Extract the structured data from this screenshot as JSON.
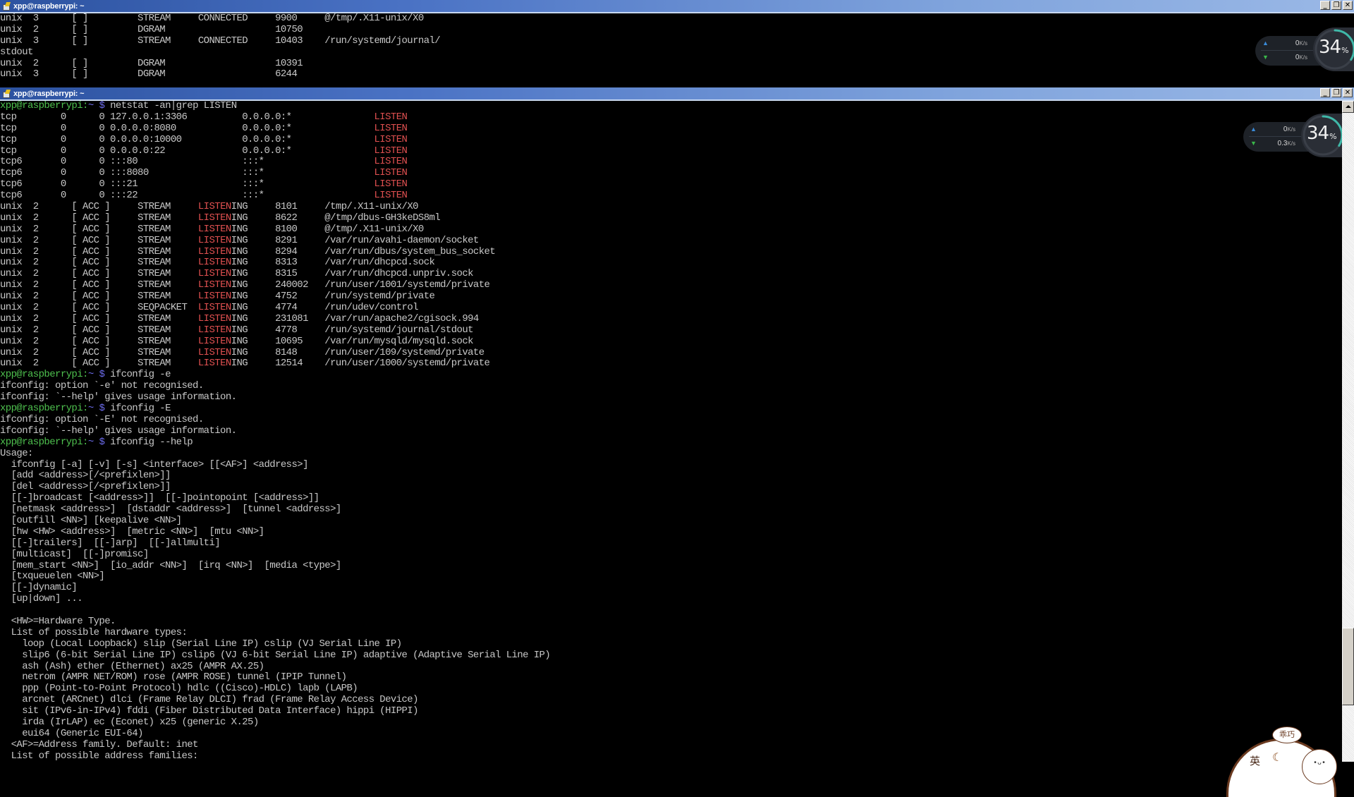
{
  "windows": {
    "top": {
      "title": "xpp@raspberrypi: ~",
      "lines": [
        {
          "segs": [
            [
              "unix  3      [ ]         STREAM     CONNECTED     9900     @/tmp/.X11-unix/X0",
              ""
            ]
          ]
        },
        {
          "segs": [
            [
              "unix  2      [ ]         DGRAM                    10750",
              ""
            ]
          ]
        },
        {
          "segs": [
            [
              "unix  3      [ ]         STREAM     CONNECTED     10403    /run/systemd/journal/",
              ""
            ]
          ]
        },
        {
          "segs": [
            [
              "stdout",
              ""
            ]
          ]
        },
        {
          "segs": [
            [
              "unix  2      [ ]         DGRAM                    10391",
              ""
            ]
          ]
        },
        {
          "segs": [
            [
              "unix  3      [ ]         DGRAM                    6244",
              ""
            ]
          ]
        }
      ]
    },
    "main": {
      "title": "xpp@raspberrypi: ~",
      "lines": [
        {
          "segs": [
            [
              "xpp@raspberrypi:",
              "g"
            ],
            [
              "~",
              "b"
            ],
            [
              " ",
              ""
            ],
            [
              "$",
              "b"
            ],
            [
              " netstat -an|grep LISTEN",
              ""
            ]
          ]
        },
        {
          "segs": [
            [
              "tcp        0      0 127.0.0.1:3306          0.0.0.0:*               ",
              ""
            ],
            [
              "LISTEN",
              "r"
            ]
          ]
        },
        {
          "segs": [
            [
              "tcp        0      0 0.0.0.0:8080            0.0.0.0:*               ",
              ""
            ],
            [
              "LISTEN",
              "r"
            ]
          ]
        },
        {
          "segs": [
            [
              "tcp        0      0 0.0.0.0:10000           0.0.0.0:*               ",
              ""
            ],
            [
              "LISTEN",
              "r"
            ]
          ]
        },
        {
          "segs": [
            [
              "tcp        0      0 0.0.0.0:22              0.0.0.0:*               ",
              ""
            ],
            [
              "LISTEN",
              "r"
            ]
          ]
        },
        {
          "segs": [
            [
              "tcp6       0      0 :::80                   :::*                    ",
              ""
            ],
            [
              "LISTEN",
              "r"
            ]
          ]
        },
        {
          "segs": [
            [
              "tcp6       0      0 :::8080                 :::*                    ",
              ""
            ],
            [
              "LISTEN",
              "r"
            ]
          ]
        },
        {
          "segs": [
            [
              "tcp6       0      0 :::21                   :::*                    ",
              ""
            ],
            [
              "LISTEN",
              "r"
            ]
          ]
        },
        {
          "segs": [
            [
              "tcp6       0      0 :::22                   :::*                    ",
              ""
            ],
            [
              "LISTEN",
              "r"
            ]
          ]
        },
        {
          "segs": [
            [
              "unix  2      [ ACC ]     STREAM     ",
              ""
            ],
            [
              "LISTEN",
              "r"
            ],
            [
              "ING     8101     /tmp/.X11-unix/X0",
              ""
            ]
          ]
        },
        {
          "segs": [
            [
              "unix  2      [ ACC ]     STREAM     ",
              ""
            ],
            [
              "LISTEN",
              "r"
            ],
            [
              "ING     8622     @/tmp/dbus-GH3keDS8ml",
              ""
            ]
          ]
        },
        {
          "segs": [
            [
              "unix  2      [ ACC ]     STREAM     ",
              ""
            ],
            [
              "LISTEN",
              "r"
            ],
            [
              "ING     8100     @/tmp/.X11-unix/X0",
              ""
            ]
          ]
        },
        {
          "segs": [
            [
              "unix  2      [ ACC ]     STREAM     ",
              ""
            ],
            [
              "LISTEN",
              "r"
            ],
            [
              "ING     8291     /var/run/avahi-daemon/socket",
              ""
            ]
          ]
        },
        {
          "segs": [
            [
              "unix  2      [ ACC ]     STREAM     ",
              ""
            ],
            [
              "LISTEN",
              "r"
            ],
            [
              "ING     8294     /var/run/dbus/system_bus_socket",
              ""
            ]
          ]
        },
        {
          "segs": [
            [
              "unix  2      [ ACC ]     STREAM     ",
              ""
            ],
            [
              "LISTEN",
              "r"
            ],
            [
              "ING     8313     /var/run/dhcpcd.sock",
              ""
            ]
          ]
        },
        {
          "segs": [
            [
              "unix  2      [ ACC ]     STREAM     ",
              ""
            ],
            [
              "LISTEN",
              "r"
            ],
            [
              "ING     8315     /var/run/dhcpcd.unpriv.sock",
              ""
            ]
          ]
        },
        {
          "segs": [
            [
              "unix  2      [ ACC ]     STREAM     ",
              ""
            ],
            [
              "LISTEN",
              "r"
            ],
            [
              "ING     240002   /run/user/1001/systemd/private",
              ""
            ]
          ]
        },
        {
          "segs": [
            [
              "unix  2      [ ACC ]     STREAM     ",
              ""
            ],
            [
              "LISTEN",
              "r"
            ],
            [
              "ING     4752     /run/systemd/private",
              ""
            ]
          ]
        },
        {
          "segs": [
            [
              "unix  2      [ ACC ]     SEQPACKET  ",
              ""
            ],
            [
              "LISTEN",
              "r"
            ],
            [
              "ING     4774     /run/udev/control",
              ""
            ]
          ]
        },
        {
          "segs": [
            [
              "unix  2      [ ACC ]     STREAM     ",
              ""
            ],
            [
              "LISTEN",
              "r"
            ],
            [
              "ING     231081   /var/run/apache2/cgisock.994",
              ""
            ]
          ]
        },
        {
          "segs": [
            [
              "unix  2      [ ACC ]     STREAM     ",
              ""
            ],
            [
              "LISTEN",
              "r"
            ],
            [
              "ING     4778     /run/systemd/journal/stdout",
              ""
            ]
          ]
        },
        {
          "segs": [
            [
              "unix  2      [ ACC ]     STREAM     ",
              ""
            ],
            [
              "LISTEN",
              "r"
            ],
            [
              "ING     10695    /var/run/mysqld/mysqld.sock",
              ""
            ]
          ]
        },
        {
          "segs": [
            [
              "unix  2      [ ACC ]     STREAM     ",
              ""
            ],
            [
              "LISTEN",
              "r"
            ],
            [
              "ING     8148     /run/user/109/systemd/private",
              ""
            ]
          ]
        },
        {
          "segs": [
            [
              "unix  2      [ ACC ]     STREAM     ",
              ""
            ],
            [
              "LISTEN",
              "r"
            ],
            [
              "ING     12514    /run/user/1000/systemd/private",
              ""
            ]
          ]
        },
        {
          "segs": [
            [
              "xpp@raspberrypi:",
              "g"
            ],
            [
              "~",
              "b"
            ],
            [
              " ",
              ""
            ],
            [
              "$",
              "b"
            ],
            [
              " ifconfig -e",
              ""
            ]
          ]
        },
        {
          "segs": [
            [
              "ifconfig: option `-e' not recognised.",
              ""
            ]
          ]
        },
        {
          "segs": [
            [
              "ifconfig: `--help' gives usage information.",
              ""
            ]
          ]
        },
        {
          "segs": [
            [
              "xpp@raspberrypi:",
              "g"
            ],
            [
              "~",
              "b"
            ],
            [
              " ",
              ""
            ],
            [
              "$",
              "b"
            ],
            [
              " ifconfig -E",
              ""
            ]
          ]
        },
        {
          "segs": [
            [
              "ifconfig: option `-E' not recognised.",
              ""
            ]
          ]
        },
        {
          "segs": [
            [
              "ifconfig: `--help' gives usage information.",
              ""
            ]
          ]
        },
        {
          "segs": [
            [
              "xpp@raspberrypi:",
              "g"
            ],
            [
              "~",
              "b"
            ],
            [
              " ",
              ""
            ],
            [
              "$",
              "b"
            ],
            [
              " ifconfig --help",
              ""
            ]
          ]
        },
        {
          "segs": [
            [
              "Usage:",
              ""
            ]
          ]
        },
        {
          "segs": [
            [
              "  ifconfig [-a] [-v] [-s] <interface> [[<AF>] <address>]",
              ""
            ]
          ]
        },
        {
          "segs": [
            [
              "  [add <address>[/<prefixlen>]]",
              ""
            ]
          ]
        },
        {
          "segs": [
            [
              "  [del <address>[/<prefixlen>]]",
              ""
            ]
          ]
        },
        {
          "segs": [
            [
              "  [[-]broadcast [<address>]]  [[-]pointopoint [<address>]]",
              ""
            ]
          ]
        },
        {
          "segs": [
            [
              "  [netmask <address>]  [dstaddr <address>]  [tunnel <address>]",
              ""
            ]
          ]
        },
        {
          "segs": [
            [
              "  [outfill <NN>] [keepalive <NN>]",
              ""
            ]
          ]
        },
        {
          "segs": [
            [
              "  [hw <HW> <address>]  [metric <NN>]  [mtu <NN>]",
              ""
            ]
          ]
        },
        {
          "segs": [
            [
              "  [[-]trailers]  [[-]arp]  [[-]allmulti]",
              ""
            ]
          ]
        },
        {
          "segs": [
            [
              "  [multicast]  [[-]promisc]",
              ""
            ]
          ]
        },
        {
          "segs": [
            [
              "  [mem_start <NN>]  [io_addr <NN>]  [irq <NN>]  [media <type>]",
              ""
            ]
          ]
        },
        {
          "segs": [
            [
              "  [txqueuelen <NN>]",
              ""
            ]
          ]
        },
        {
          "segs": [
            [
              "  [[-]dynamic]",
              ""
            ]
          ]
        },
        {
          "segs": [
            [
              "  [up|down] ...",
              ""
            ]
          ]
        },
        {
          "segs": [
            [
              "",
              ""
            ]
          ]
        },
        {
          "segs": [
            [
              "  <HW>=Hardware Type.",
              ""
            ]
          ]
        },
        {
          "segs": [
            [
              "  List of possible hardware types:",
              ""
            ]
          ]
        },
        {
          "segs": [
            [
              "    loop (Local Loopback) slip (Serial Line IP) cslip (VJ Serial Line IP)",
              ""
            ]
          ]
        },
        {
          "segs": [
            [
              "    slip6 (6-bit Serial Line IP) cslip6 (VJ 6-bit Serial Line IP) adaptive (Adaptive Serial Line IP)",
              ""
            ]
          ]
        },
        {
          "segs": [
            [
              "    ash (Ash) ether (Ethernet) ax25 (AMPR AX.25)",
              ""
            ]
          ]
        },
        {
          "segs": [
            [
              "    netrom (AMPR NET/ROM) rose (AMPR ROSE) tunnel (IPIP Tunnel)",
              ""
            ]
          ]
        },
        {
          "segs": [
            [
              "    ppp (Point-to-Point Protocol) hdlc ((Cisco)-HDLC) lapb (LAPB)",
              ""
            ]
          ]
        },
        {
          "segs": [
            [
              "    arcnet (ARCnet) dlci (Frame Relay DLCI) frad (Frame Relay Access Device)",
              ""
            ]
          ]
        },
        {
          "segs": [
            [
              "    sit (IPv6-in-IPv4) fddi (Fiber Distributed Data Interface) hippi (HIPPI)",
              ""
            ]
          ]
        },
        {
          "segs": [
            [
              "    irda (IrLAP) ec (Econet) x25 (generic X.25)",
              ""
            ]
          ]
        },
        {
          "segs": [
            [
              "    eui64 (Generic EUI-64)",
              ""
            ]
          ]
        },
        {
          "segs": [
            [
              "  <AF>=Address family. Default: inet",
              ""
            ]
          ]
        },
        {
          "segs": [
            [
              "  List of possible address families:",
              ""
            ]
          ]
        }
      ]
    }
  },
  "window_controls": {
    "minimize": "_",
    "restore": "❐",
    "close": "✕"
  },
  "net_monitor": [
    {
      "upload_value": "0",
      "upload_unit": "K/s",
      "download_value": "0",
      "download_unit": "K/s",
      "percent": "34",
      "percent_sign": "%",
      "percent_fraction": 0.34
    },
    {
      "upload_value": "0",
      "upload_unit": "K/s",
      "download_value": "0.3",
      "download_unit": "K/s",
      "percent": "34",
      "percent_sign": "%",
      "percent_fraction": 0.34
    }
  ],
  "ime_widget": {
    "bubble_text": "乖巧",
    "lang_label": "英",
    "moon": "☾"
  },
  "colors": {
    "prompt_green": "#4ec04e",
    "prompt_blue": "#6a6ae8",
    "listen_red": "#e05050",
    "terminal_fg": "#c8c8c8",
    "terminal_bg": "#000000",
    "ring_accent": "#3fb8a8"
  }
}
